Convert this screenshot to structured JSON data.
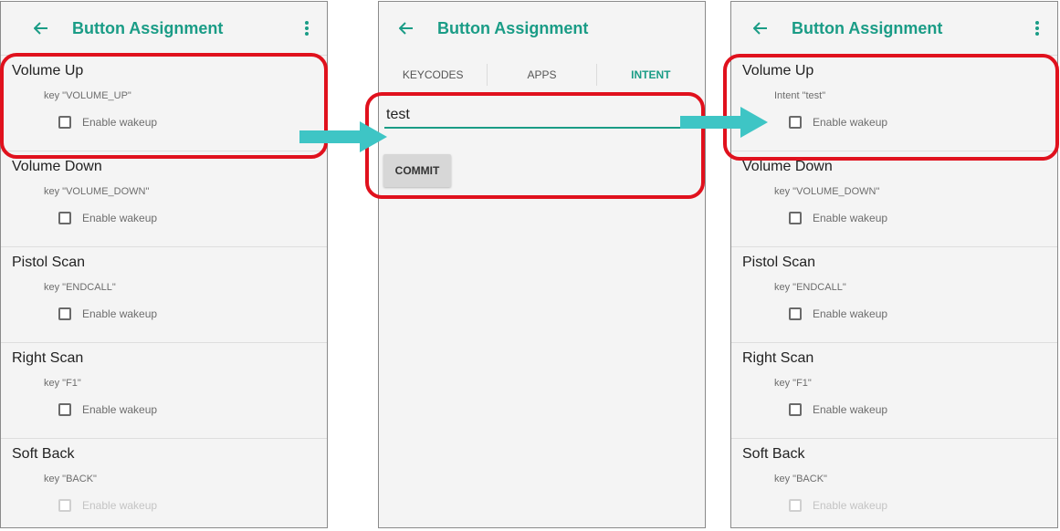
{
  "app_bar": {
    "title": "Button Assignment",
    "back_icon": "arrow-left-icon",
    "menu_icon": "more-vertical-icon"
  },
  "colors": {
    "accent": "#1a9c86",
    "highlight": "#e0111d",
    "arrow": "#3ec5c5"
  },
  "left_screen": {
    "items": [
      {
        "name": "Volume Up",
        "key": "key \"VOLUME_UP\"",
        "wakeup_label": "Enable wakeup",
        "wakeup_checked": false
      },
      {
        "name": "Volume Down",
        "key": "key \"VOLUME_DOWN\"",
        "wakeup_label": "Enable wakeup",
        "wakeup_checked": false
      },
      {
        "name": "Pistol Scan",
        "key": "key \"ENDCALL\"",
        "wakeup_label": "Enable wakeup",
        "wakeup_checked": false
      },
      {
        "name": "Right Scan",
        "key": "key \"F1\"",
        "wakeup_label": "Enable wakeup",
        "wakeup_checked": false
      },
      {
        "name": "Soft Back",
        "key": "key \"BACK\"",
        "wakeup_label": "Enable wakeup",
        "wakeup_checked": false,
        "wakeup_disabled": true
      }
    ]
  },
  "middle_screen": {
    "tabs": [
      {
        "label": "KEYCODES",
        "active": false
      },
      {
        "label": "APPS",
        "active": false
      },
      {
        "label": "INTENT",
        "active": true
      }
    ],
    "intent_value": "test",
    "commit_label": "COMMIT"
  },
  "right_screen": {
    "items": [
      {
        "name": "Volume Up",
        "key": "Intent \"test\"",
        "wakeup_label": "Enable wakeup",
        "wakeup_checked": false
      },
      {
        "name": "Volume Down",
        "key": "key \"VOLUME_DOWN\"",
        "wakeup_label": "Enable wakeup",
        "wakeup_checked": false
      },
      {
        "name": "Pistol Scan",
        "key": "key \"ENDCALL\"",
        "wakeup_label": "Enable wakeup",
        "wakeup_checked": false
      },
      {
        "name": "Right Scan",
        "key": "key \"F1\"",
        "wakeup_label": "Enable wakeup",
        "wakeup_checked": false
      },
      {
        "name": "Soft Back",
        "key": "key \"BACK\"",
        "wakeup_label": "Enable wakeup",
        "wakeup_checked": false,
        "wakeup_disabled": true
      }
    ]
  }
}
